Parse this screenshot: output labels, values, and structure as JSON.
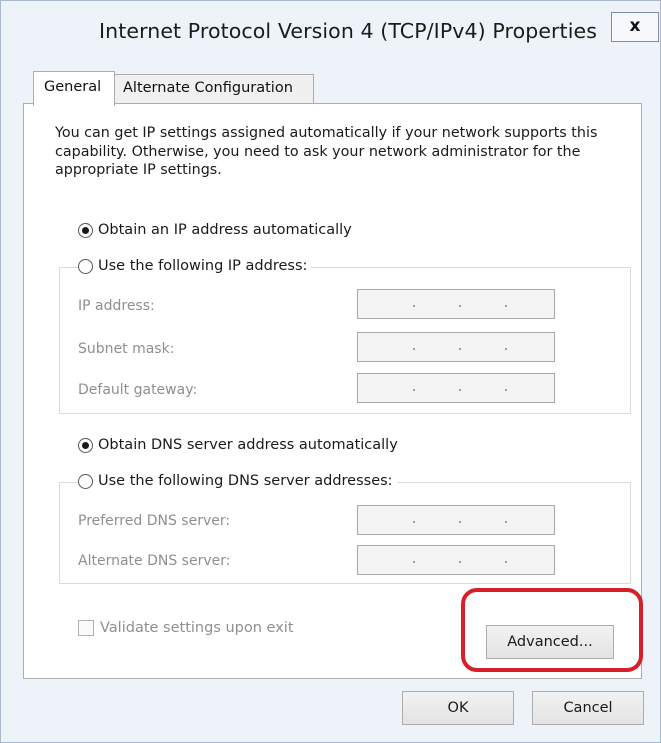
{
  "window": {
    "title": "Internet Protocol Version 4 (TCP/IPv4) Properties",
    "close_glyph": "x"
  },
  "tabs": [
    {
      "label": "General",
      "selected": true
    },
    {
      "label": "Alternate Configuration",
      "selected": false
    }
  ],
  "general": {
    "intro": "You can get IP settings assigned automatically if your network supports this capability. Otherwise, you need to ask your network administrator for the appropriate IP settings.",
    "ip_mode": {
      "auto_label": "Obtain an IP address automatically",
      "manual_label": "Use the following IP address:",
      "selected": "auto",
      "fields": [
        {
          "label": "IP address:",
          "value": ". . ."
        },
        {
          "label": "Subnet mask:",
          "value": ". . ."
        },
        {
          "label": "Default gateway:",
          "value": ". . ."
        }
      ]
    },
    "dns_mode": {
      "auto_label": "Obtain DNS server address automatically",
      "manual_label": "Use the following DNS server addresses:",
      "selected": "auto",
      "fields": [
        {
          "label": "Preferred DNS server:",
          "value": ". . ."
        },
        {
          "label": "Alternate DNS server:",
          "value": ". . ."
        }
      ]
    },
    "validate_label": "Validate settings upon exit",
    "validate_checked": false,
    "advanced_label": "Advanced..."
  },
  "footer": {
    "ok_label": "OK",
    "cancel_label": "Cancel"
  },
  "colors": {
    "highlight": "#d61f2a",
    "window_bg": "#eef3f9",
    "disabled_text": "#8f8f8f"
  }
}
